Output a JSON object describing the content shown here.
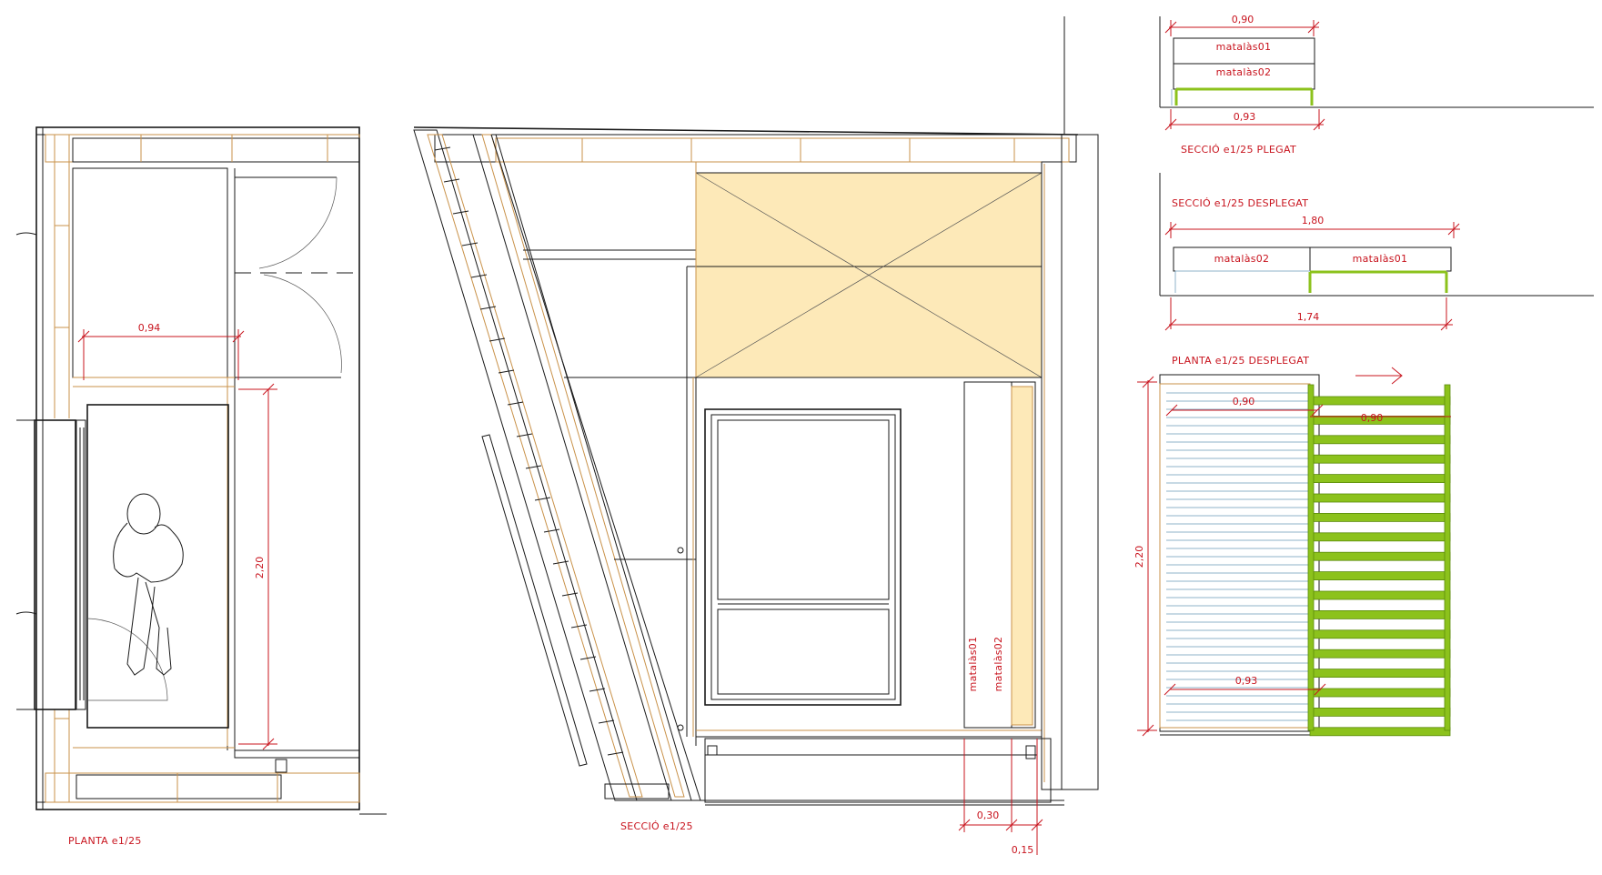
{
  "titles": {
    "planta": "PLANTA e1/25",
    "seccio": "SECCIÓ e1/25",
    "seccio_plegat": "SECCIÓ e1/25 PLEGAT",
    "seccio_desplegat": "SECCIÓ e1/25 DESPLEGAT",
    "planta_desplegat": "PLANTA e1/25 DESPLEGAT"
  },
  "dimensions": {
    "planta_width": "0,94",
    "planta_length": "2,20",
    "seccio_030": "0,30",
    "seccio_015": "0,15",
    "plegat_top": "0,90",
    "plegat_bottom": "0,93",
    "desplegat_top": "1,80",
    "desplegat_bottom": "1,74",
    "pd_top_left": "0,90",
    "pd_top_right": "0,90",
    "pd_bottom": "0,93",
    "pd_length": "2,20"
  },
  "mattress_labels": {
    "m1": "matalàs01",
    "m2": "matalàs02"
  },
  "colors": {
    "dimension_red": "#c8141e",
    "wood_frame": "#c9924a",
    "infill_yellow": "#fde9b8",
    "slat_green": "#8cc21c",
    "slat_blue": "#8fb3c9"
  }
}
